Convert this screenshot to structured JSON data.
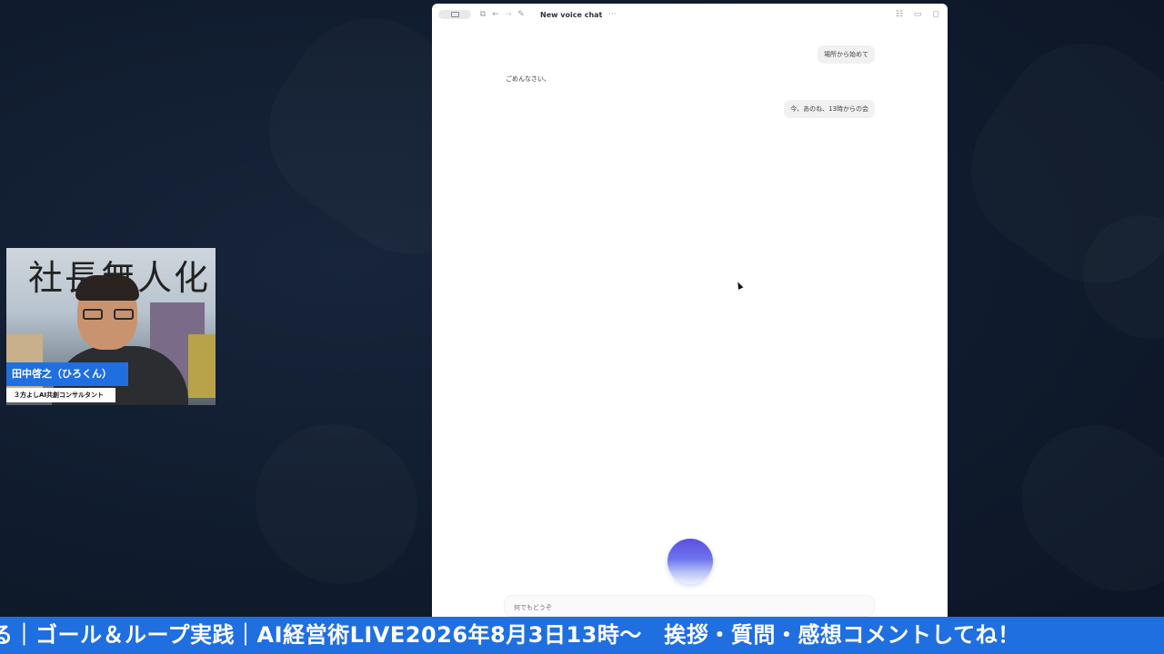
{
  "window": {
    "title": "New voice chat",
    "more_label": "···"
  },
  "conversation": {
    "messages": [
      {
        "role": "user",
        "text": "場所から始めて"
      },
      {
        "role": "assistant",
        "text": "ごめんなさい、"
      },
      {
        "role": "user",
        "text": "今、あのね、13時からの会"
      }
    ]
  },
  "composer": {
    "placeholder": "何でもどうぞ"
  },
  "icons": {
    "sidebar_toggle": "sidebar-toggle-icon",
    "new_chat": "new-chat-icon",
    "back": "arrow-left-icon",
    "forward": "arrow-right-icon",
    "edit": "edit-icon",
    "more": "more-icon",
    "settings": "settings-sliders-icon",
    "panel": "panel-icon",
    "expand": "expand-icon"
  },
  "webcam": {
    "banner_text": "社長無人化",
    "presenter_name": "田中啓之（ひろくん）",
    "presenter_role": "３方よしAI共創コンサルタント"
  },
  "ticker": {
    "text": "る｜ゴール＆ループ実践｜AI経営術LIVE2026年8月3日13時〜　挨拶・質問・感想コメントしてね！"
  },
  "colors": {
    "ticker_bg": "#1f6fe0",
    "name_tag_bg": "#1f6fe0",
    "background": "#0f1a2c",
    "orb_top": "#5b4fe0"
  }
}
